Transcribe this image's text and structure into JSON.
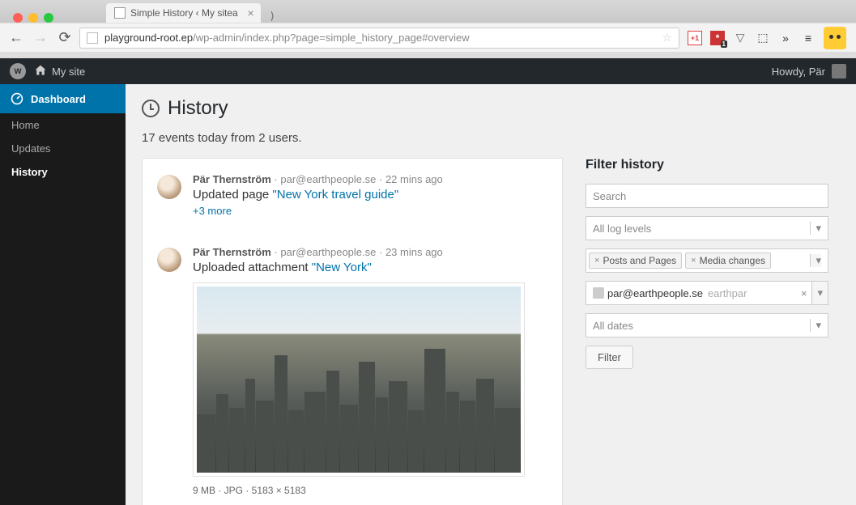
{
  "browser": {
    "tab_title": "Simple History ‹ My sitea",
    "url_domain": "playground-root.ep",
    "url_path": "/wp-admin/index.php?page=simple_history_page#overview",
    "extensions_badge": "1"
  },
  "adminbar": {
    "site_name": "My site",
    "howdy": "Howdy, Pär"
  },
  "sidebar": {
    "dashboard": "Dashboard",
    "items": [
      "Home",
      "Updates",
      "History"
    ],
    "current_index": 2
  },
  "page": {
    "title": "History",
    "summary": "17 events today from 2 users."
  },
  "events": [
    {
      "author": "Pär Thernström",
      "email": "par@earthpeople.se",
      "time": "22 mins ago",
      "action_prefix": "Updated page ",
      "action_link": "\"New York travel guide\"",
      "more": "+3 more"
    },
    {
      "author": "Pär Thernström",
      "email": "par@earthpeople.se",
      "time": "23 mins ago",
      "action_prefix": "Uploaded attachment ",
      "action_link": "\"New York\"",
      "attachment": {
        "meta": "9 MB · JPG · 5183 × 5183"
      }
    }
  ],
  "filter": {
    "heading": "Filter history",
    "search_placeholder": "Search",
    "log_levels_placeholder": "All log levels",
    "tags": [
      "Posts and Pages",
      "Media changes"
    ],
    "user_email": "par@earthpeople.se",
    "user_search_suffix": "earthpar",
    "dates_placeholder": "All dates",
    "button": "Filter"
  }
}
